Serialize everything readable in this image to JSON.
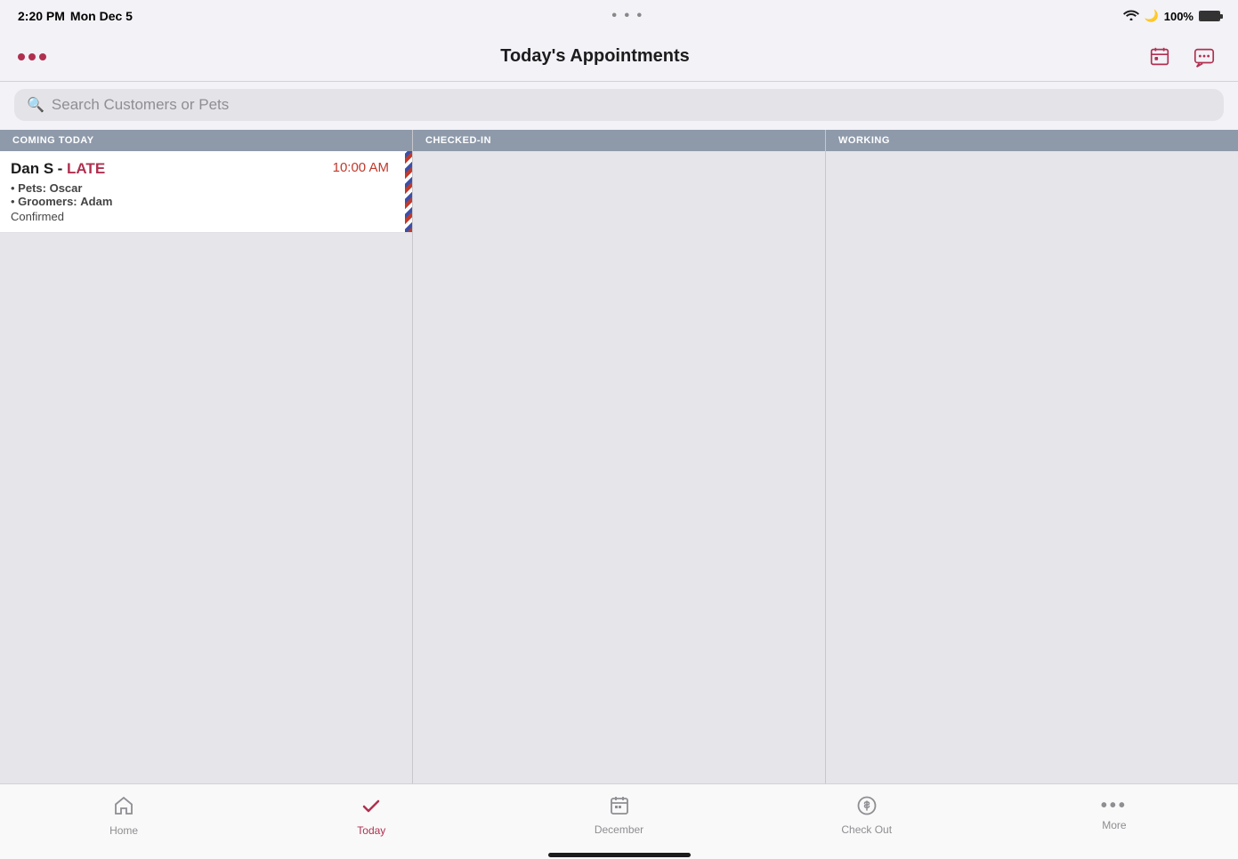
{
  "statusBar": {
    "time": "2:20 PM",
    "date": "Mon Dec 5",
    "battery": "100%"
  },
  "navBar": {
    "title": "Today's Appointments",
    "dotsLabel": "···"
  },
  "search": {
    "placeholder": "Search Customers or Pets"
  },
  "columns": [
    {
      "id": "coming-today",
      "header": "COMING TODAY"
    },
    {
      "id": "checked-in",
      "header": "CHECKED-IN"
    },
    {
      "id": "working",
      "header": "WORKING"
    }
  ],
  "appointments": [
    {
      "name": "Dan S",
      "status": "LATE",
      "time": "10:00 AM",
      "pet": "Oscar",
      "groomer": "Adam",
      "confirmStatus": "Confirmed"
    }
  ],
  "tabBar": {
    "items": [
      {
        "id": "home",
        "label": "Home",
        "icon": "🏠",
        "active": false
      },
      {
        "id": "today",
        "label": "Today",
        "icon": "✔",
        "active": true
      },
      {
        "id": "december",
        "label": "December",
        "icon": "📅",
        "active": false
      },
      {
        "id": "checkout",
        "label": "Check Out",
        "icon": "$",
        "active": false
      },
      {
        "id": "more",
        "label": "More",
        "icon": "•••",
        "active": false
      }
    ]
  }
}
